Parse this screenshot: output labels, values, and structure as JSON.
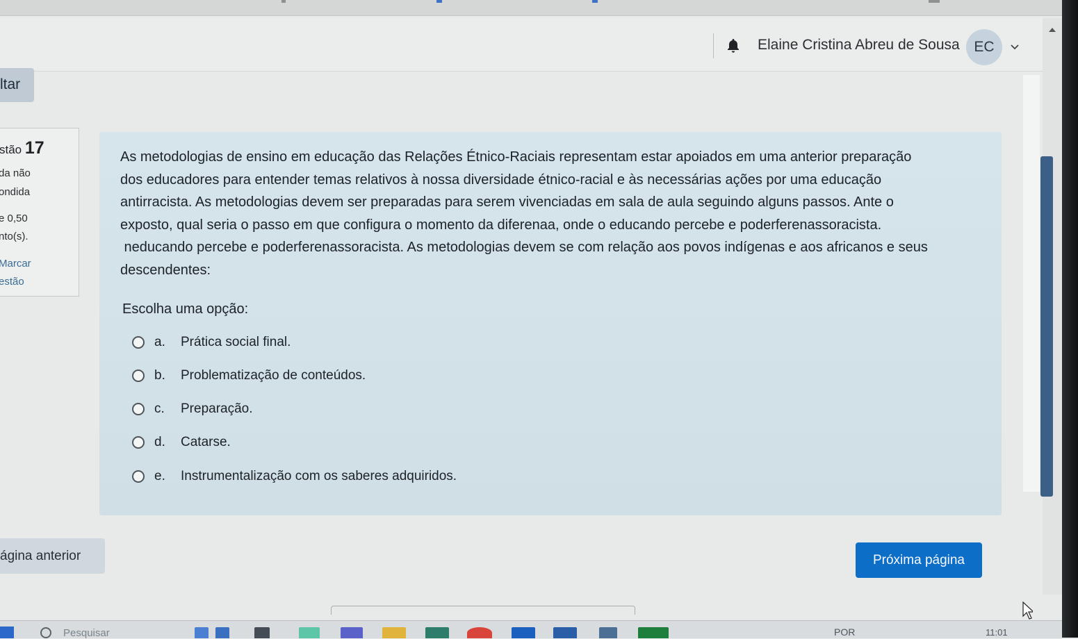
{
  "header": {
    "user_name": "Elaine Cristina Abreu de Sousa",
    "avatar_initials": "EC",
    "icons": [
      "bell-icon",
      "chevron-down-icon"
    ]
  },
  "nav": {
    "back_label": "ltar",
    "prev_page_label": "ágina anterior",
    "next_page_label": "Próxima página"
  },
  "question_info": {
    "label": "stão",
    "number": "17",
    "status_line1": "da não",
    "status_line2": "ondida",
    "score_line1": "e 0,50",
    "score_line2": "nto(s).",
    "flag_line1": "Marcar",
    "flag_line2": "estão"
  },
  "question": {
    "lines": [
      "As metodologias de ensino em educação das Relações Étnico-Raciais representam estar apoiados em uma anterior preparação",
      "dos educadores para entender temas relativos à nossa diversidade étnico-racial e às necessárias ações por uma educação",
      "antirracista. As metodologias devem ser preparadas para serem vivenciadas em sala de aula seguindo alguns passos. Ante o",
      "exposto, qual seria o passo em que configura o momento da diferenaa, onde o educando percebe e poderferenassoracista.",
      " neducando percebe e poderferenassoracista. As metodologias devem se com relação aos povos indígenas e aos africanos e seus",
      "descendentes:"
    ],
    "prompt": "Escolha uma opção:",
    "options": [
      {
        "letter": "a.",
        "text": "Prática social final."
      },
      {
        "letter": "b.",
        "text": "Problematização de conteúdos."
      },
      {
        "letter": "c.",
        "text": "Preparação."
      },
      {
        "letter": "d.",
        "text": "Catarse."
      },
      {
        "letter": "e.",
        "text": "Instrumentalização com os saberes adquiridos."
      }
    ]
  },
  "taskbar": {
    "search_placeholder": "Pesquisar",
    "language": "POR",
    "clock": "11:01",
    "colors": {
      "start": "#2b68c9",
      "accent": "#0d6ec7"
    }
  }
}
